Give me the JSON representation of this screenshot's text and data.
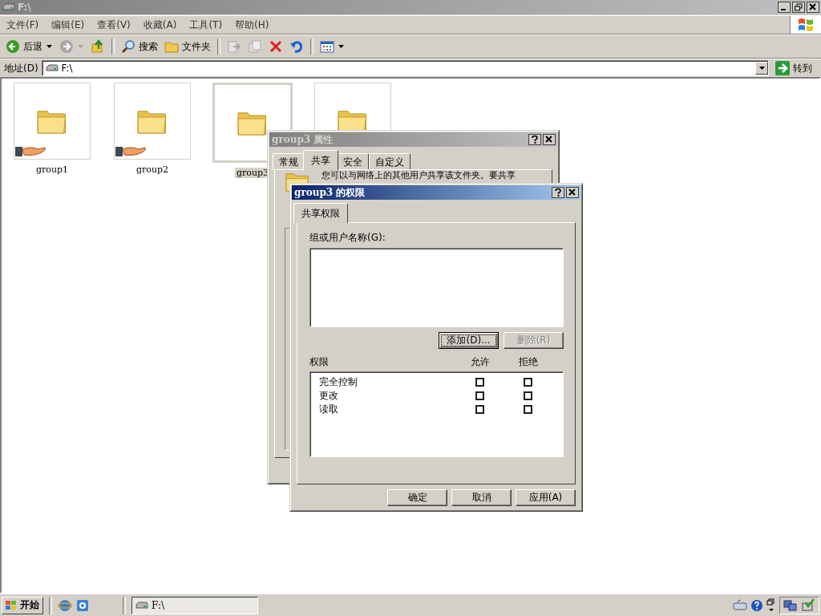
{
  "window": {
    "title": "F:\\",
    "active": false
  },
  "menu": [
    "文件(F)",
    "编辑(E)",
    "查看(V)",
    "收藏(A)",
    "工具(T)",
    "帮助(H)"
  ],
  "toolbar": [
    {
      "kind": "back",
      "label": "后退",
      "disabled": false,
      "dropdown": true
    },
    {
      "kind": "forward",
      "disabled": true,
      "dropdown": true
    },
    {
      "kind": "up",
      "disabled": false
    },
    {
      "kind": "separator"
    },
    {
      "kind": "search",
      "label": "搜索",
      "disabled": false
    },
    {
      "kind": "folders",
      "label": "文件夹",
      "disabled": false
    },
    {
      "kind": "separator"
    },
    {
      "kind": "move",
      "disabled": true
    },
    {
      "kind": "copy",
      "disabled": true
    },
    {
      "kind": "delete",
      "disabled": false
    },
    {
      "kind": "undo",
      "disabled": false
    },
    {
      "kind": "separator"
    },
    {
      "kind": "views",
      "disabled": false,
      "dropdown": true
    }
  ],
  "address": {
    "label": "地址(D)",
    "value": "F:\\",
    "go": "转到"
  },
  "files": [
    {
      "name": "group1",
      "shared": true,
      "selected": false
    },
    {
      "name": "group2",
      "shared": true,
      "selected": false
    },
    {
      "name": "group3",
      "shared": false,
      "selected": true
    },
    {
      "selected": false
    }
  ],
  "properties_dialog": {
    "title": "group3 属性",
    "active": false,
    "tabs": [
      {
        "label": "常规",
        "selected": false
      },
      {
        "label": "共享",
        "selected": true
      },
      {
        "label": "安全",
        "selected": false
      },
      {
        "label": "自定义",
        "selected": false
      }
    ],
    "text": "您可以与网络上的其他用户共享该文件夹。要共享"
  },
  "permissions_dialog": {
    "title": "group3 的权限",
    "active": true,
    "tabs": [
      {
        "label": "共享权限",
        "selected": true
      }
    ],
    "group_label": "组或用户名称(G):",
    "buttons": [
      {
        "label": "添加(D)...",
        "disabled": false,
        "focused": true
      },
      {
        "label": "删除(R)",
        "disabled": true,
        "focused": false
      }
    ],
    "columns": [
      "权限",
      "允许",
      "拒绝"
    ],
    "permissions": [
      {
        "name": "完全控制",
        "allow": false,
        "deny": false
      },
      {
        "name": "更改",
        "allow": false,
        "deny": false
      },
      {
        "name": "读取",
        "allow": false,
        "deny": false
      }
    ],
    "footer_buttons": [
      "确定",
      "取消",
      "应用(A)"
    ]
  },
  "taskbar": {
    "start": "开始",
    "tasks": [
      {
        "label": "F:\\",
        "selected": true
      }
    ]
  }
}
